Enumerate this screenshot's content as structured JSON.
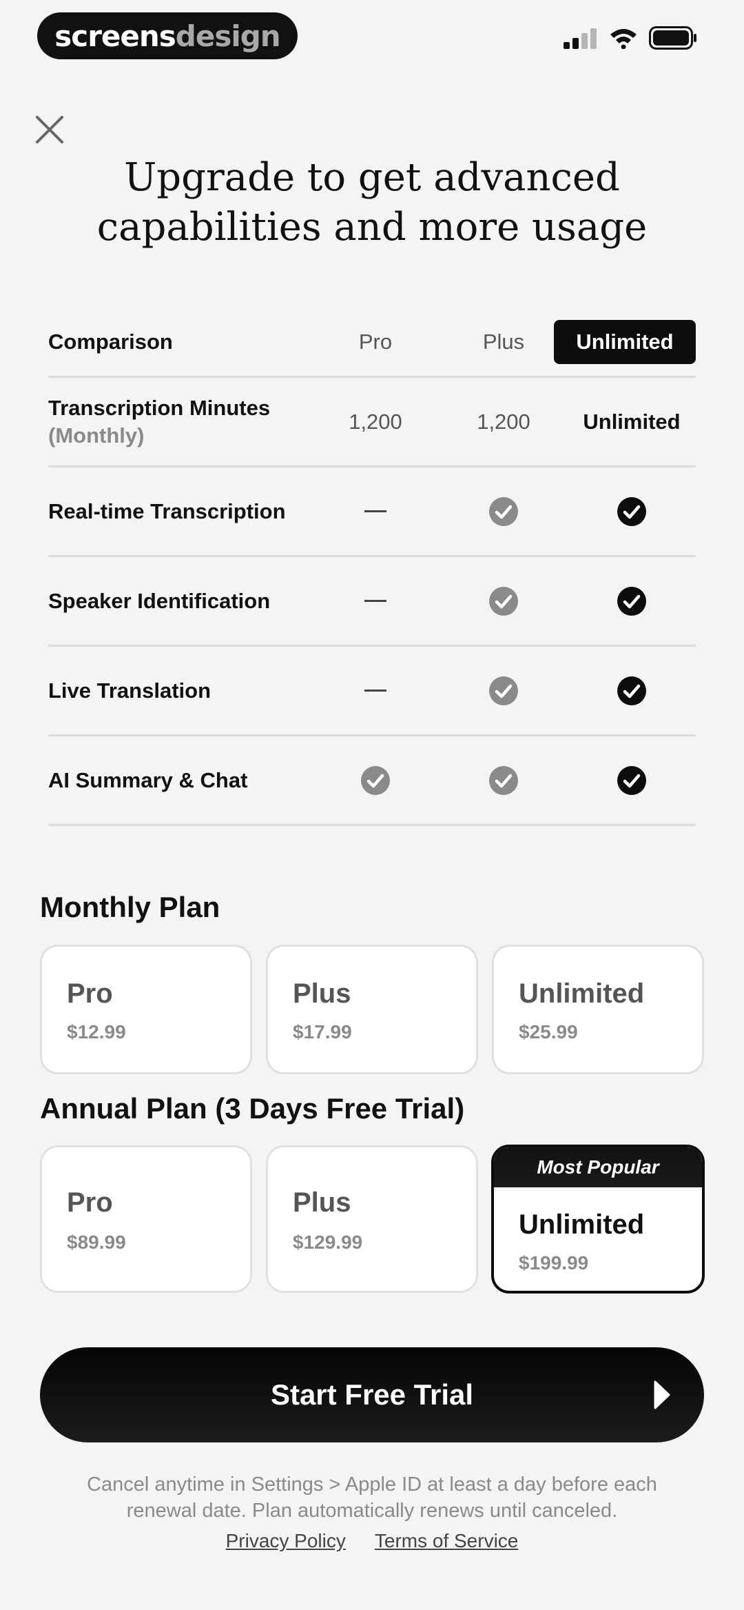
{
  "status_bar": {
    "brand_primary": "screens",
    "brand_secondary": "design",
    "icons": [
      "cellular-signal-icon",
      "wifi-icon",
      "battery-icon"
    ]
  },
  "header": {
    "close_icon": "close-icon",
    "title_line1": "Upgrade to get advanced",
    "title_line2": "capabilities and more usage"
  },
  "comparison": {
    "header": {
      "label": "Comparison",
      "col1": "Pro",
      "col2": "Plus",
      "col3": "Unlimited"
    },
    "rows": [
      {
        "feature": "Transcription Minutes",
        "sub": "(Monthly)",
        "pro": "1,200",
        "plus": "1,200",
        "unlimited": "Unlimited"
      },
      {
        "feature": "Real-time Transcription",
        "pro": "dash",
        "plus": "check",
        "unlimited": "check"
      },
      {
        "feature": "Speaker Identification",
        "pro": "dash",
        "plus": "check",
        "unlimited": "check"
      },
      {
        "feature": "Live Translation",
        "pro": "dash",
        "plus": "check",
        "unlimited": "check"
      },
      {
        "feature": "AI Summary & Chat",
        "pro": "check",
        "plus": "check",
        "unlimited": "check"
      }
    ]
  },
  "monthly": {
    "title": "Monthly Plan",
    "plans": [
      {
        "name": "Pro",
        "price": "$12.99"
      },
      {
        "name": "Plus",
        "price": "$17.99"
      },
      {
        "name": "Unlimited",
        "price": "$25.99"
      }
    ]
  },
  "annual": {
    "title": "Annual Plan (3 Days Free Trial)",
    "badge": "Most Popular",
    "selected": "Unlimited",
    "plans": [
      {
        "name": "Pro",
        "price": "$89.99"
      },
      {
        "name": "Plus",
        "price": "$129.99"
      },
      {
        "name": "Unlimited",
        "price": "$199.99"
      }
    ]
  },
  "cta": {
    "label": "Start Free Trial",
    "icon": "play-arrow-icon"
  },
  "footer": {
    "fineprint_line1": "Cancel anytime in Settings > Apple ID at least a day before each",
    "fineprint_line2": "renewal date. Plan automatically renews until canceled.",
    "privacy": "Privacy Policy",
    "terms": "Terms of Service"
  },
  "colors": {
    "background": "#f4f4f4",
    "accent": "#0d0d0d",
    "muted_check": "#8a8a8a"
  }
}
